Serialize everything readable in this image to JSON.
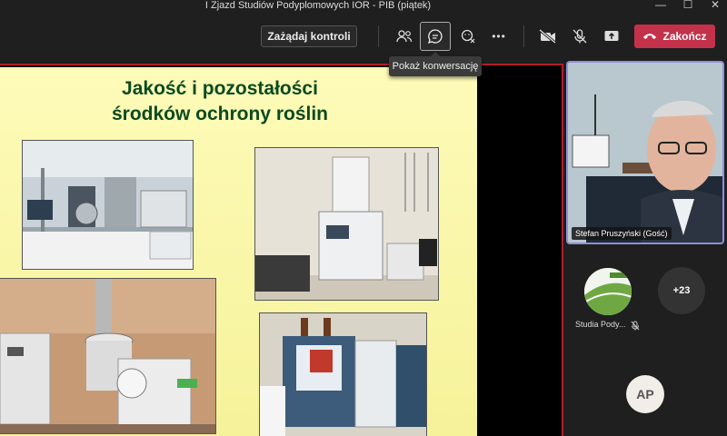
{
  "window": {
    "title": "I Zjazd Studiów Podyplomowych IOR - PIB (piątek)",
    "controls": [
      "—",
      "☐",
      "✕"
    ]
  },
  "toolbar": {
    "request_control_label": "Zażądaj kontroli",
    "icons": [
      "people-icon",
      "chat-icon",
      "reactions-icon",
      "more-icon",
      "camera-off-icon",
      "mic-off-icon",
      "share-icon"
    ],
    "more_label": "•••",
    "end_label": "Zakończ",
    "tooltip": "Pokaż konwersację"
  },
  "slide": {
    "title_line1": "Jakość i pozostałości",
    "title_line2": "środków ochrony roślin",
    "background": "#fdfbb8",
    "title_color": "#0b4a20"
  },
  "participants": {
    "featured_name": "Stefan Pruszyński (Gość)",
    "tile2_label": "Studia Pody...",
    "overflow_count": "+23",
    "initials": "AP"
  },
  "colors": {
    "accent_end": "#c4314b",
    "active_speaker": "#8f8fd8",
    "share_border": "#b11f2b"
  }
}
